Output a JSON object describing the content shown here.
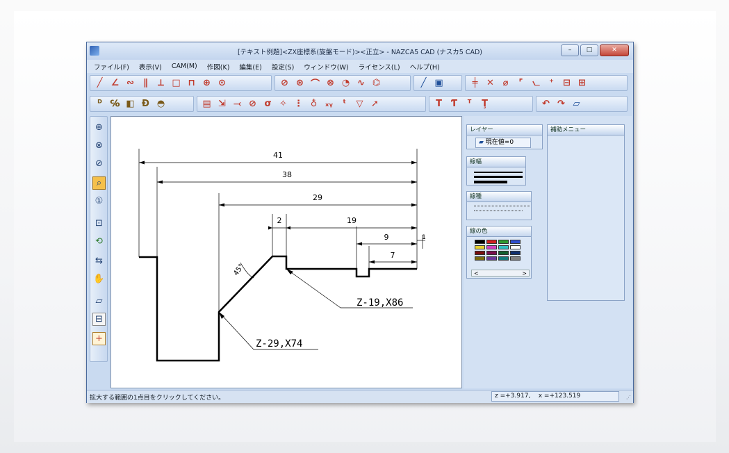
{
  "window": {
    "title": "[テキスト例題]<ZX座標系(旋盤モード)><正立> - NAZCA5 CAD (ナスカ5 CAD)",
    "min_label": "–",
    "max_label": "□",
    "close_label": "✕"
  },
  "menu": [
    {
      "label": "ファイル(F)"
    },
    {
      "label": "表示(V)"
    },
    {
      "label": "CAM(M)"
    },
    {
      "label": "作図(K)"
    },
    {
      "label": "編集(E)"
    },
    {
      "label": "設定(S)"
    },
    {
      "label": "ウィンドウ(W)"
    },
    {
      "label": "ライセンス(L)"
    },
    {
      "label": "ヘルプ(H)"
    }
  ],
  "toolbar_row1": [
    "line",
    "angle-line",
    "tangent",
    "parallel",
    "perpendicular",
    "rectangle",
    "polygon",
    "circle-center",
    "circle-3pt",
    "circle-tangent",
    "circle-offset",
    "arc",
    "arc-tangent",
    "arc-3pt",
    "spline",
    "polyline",
    "line-select",
    "box-select",
    "trim",
    "delete",
    "break",
    "rc-corner",
    "chamfer",
    "point",
    "measure-a",
    "measure-b"
  ],
  "toolbar_row2": [
    "dim-1",
    "dim-2",
    "dim-3",
    "dim-4",
    "dim-5",
    "hatch",
    "dim-line",
    "dim-angle",
    "dim-radius",
    "dim-diameter",
    "symbol",
    "thread",
    "xy",
    "txy",
    "weld",
    "arrow",
    "text-1",
    "text-2",
    "text-3",
    "text-4",
    "undo",
    "redo",
    "layer-edit"
  ],
  "vtools": [
    "zoom-in",
    "zoom-window",
    "zoom-half",
    "zoom-all",
    "zoom-prev",
    "pan-center",
    "refresh",
    "move-arrows",
    "hand",
    "layer",
    "print",
    "add"
  ],
  "drawing": {
    "dims": [
      "41",
      "38",
      "29",
      "2",
      "19",
      "9",
      "1",
      "7"
    ],
    "angle_label": "45°",
    "leader1": "Z-19,X86",
    "leader2": "Z-29,X74"
  },
  "panel": {
    "layer": {
      "title": "レイヤー",
      "value": "現在値=0"
    },
    "line_width": {
      "title": "線幅"
    },
    "line_type": {
      "title": "線種"
    },
    "line_color": {
      "title": "線の色"
    },
    "aux_menu": {
      "title": "補助メニュー"
    },
    "scroll_left": "<",
    "scroll_right": ">"
  },
  "status": {
    "message": "拡大する範囲の1点目をクリックしてください。",
    "coords": "z =+3.917,    x =+123.519"
  }
}
